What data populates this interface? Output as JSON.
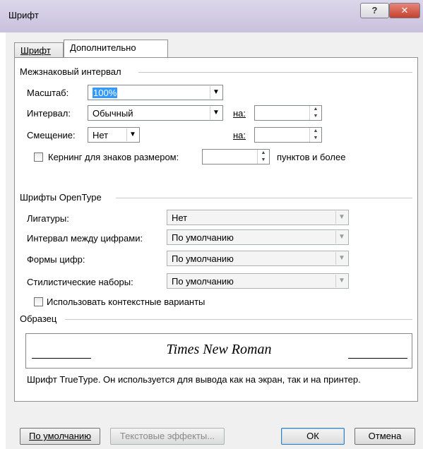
{
  "window": {
    "title": "Шрифт",
    "help_label": "?",
    "close_label": "✕"
  },
  "tabs": [
    {
      "label": "Шрифт",
      "active": false
    },
    {
      "label": "Дополнительно",
      "active": true
    }
  ],
  "spacing": {
    "group_title": "Межзнаковый интервал",
    "scale_label": "Масштаб:",
    "scale_value": "100%",
    "interval_label": "Интервал:",
    "interval_value": "Обычный",
    "interval_by_label": "на:",
    "interval_by_value": "",
    "position_label": "Смещение:",
    "position_value": "Нет",
    "position_by_label": "на:",
    "position_by_value": "",
    "kerning_label": "Кернинг для знаков размером:",
    "kerning_checked": false,
    "kerning_value": "",
    "kerning_suffix": "пунктов и более"
  },
  "opentype": {
    "group_title": "Шрифты OpenType",
    "ligatures_label": "Лигатуры:",
    "ligatures_value": "Нет",
    "numspacing_label": "Интервал между цифрами:",
    "numspacing_value": "По умолчанию",
    "numforms_label": "Формы цифр:",
    "numforms_value": "По умолчанию",
    "stylistic_label": "Стилистические наборы:",
    "stylistic_value": "По умолчанию",
    "contextual_label": "Использовать контекстные варианты",
    "contextual_checked": false
  },
  "preview": {
    "group_title": "Образец",
    "sample_text": "Times New Roman",
    "description": "Шрифт TrueType. Он используется для вывода как на экран, так и на принтер."
  },
  "buttons": {
    "default_label": "По умолчанию",
    "text_effects_label": "Текстовые эффекты...",
    "ok_label": "ОК",
    "cancel_label": "Отмена"
  },
  "icons": {
    "dropdown_arrow": "▼",
    "spin_up": "▲",
    "spin_down": "▼"
  },
  "colors": {
    "title_bar": "#cfc8e0",
    "close_button": "#c8432f",
    "selection": "#3399ff",
    "dialog_bg": "#f0f0f0"
  }
}
